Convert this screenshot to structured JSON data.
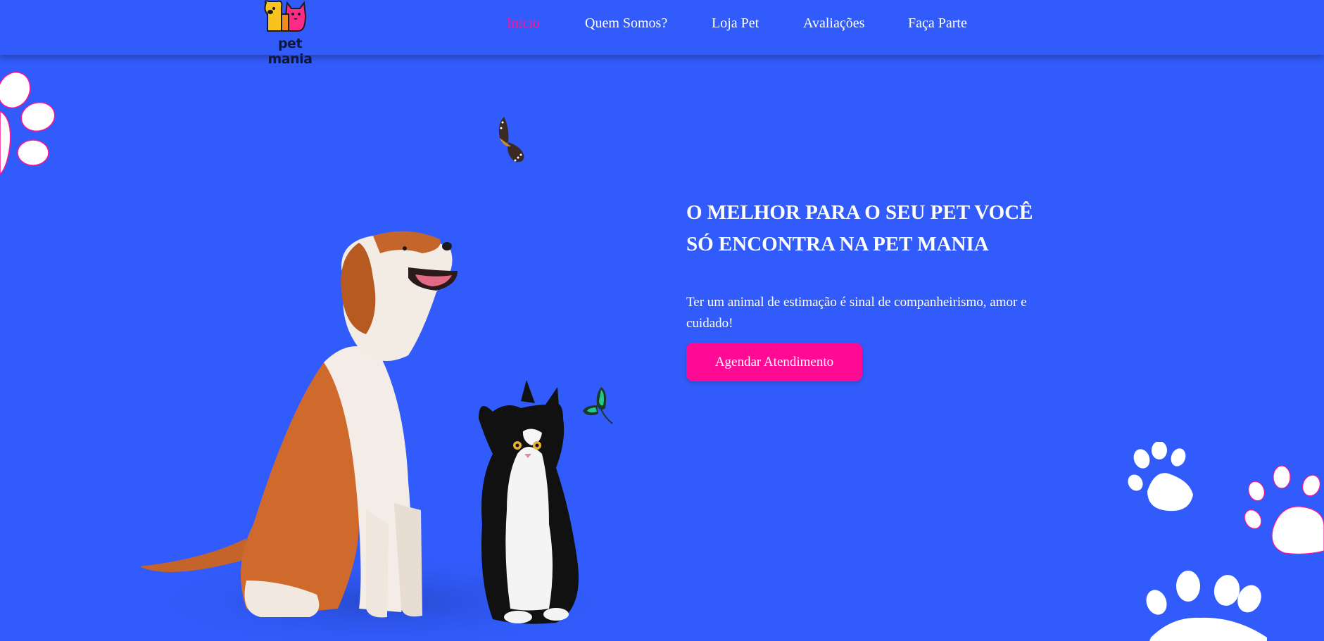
{
  "brand": {
    "logo_text": "pet mania",
    "logo_icon": "dog-and-cat-logo"
  },
  "nav": {
    "items": [
      {
        "label": "Início",
        "active": true
      },
      {
        "label": "Quem Somos?",
        "active": false
      },
      {
        "label": "Loja Pet",
        "active": false
      },
      {
        "label": "Avaliações",
        "active": false
      },
      {
        "label": "Faça Parte",
        "active": false
      }
    ]
  },
  "hero": {
    "title": "O MELHOR PARA O SEU PET VOCÊ SÓ ENCONTRA NA PET MANIA",
    "subtitle": "Ter um animal de estimação é sinal de companheirismo, amor e cuidado!",
    "cta_label": "Agendar Atendimento"
  },
  "colors": {
    "background": "#315bfa",
    "accent": "#ff0a95",
    "text": "#ffffff"
  }
}
